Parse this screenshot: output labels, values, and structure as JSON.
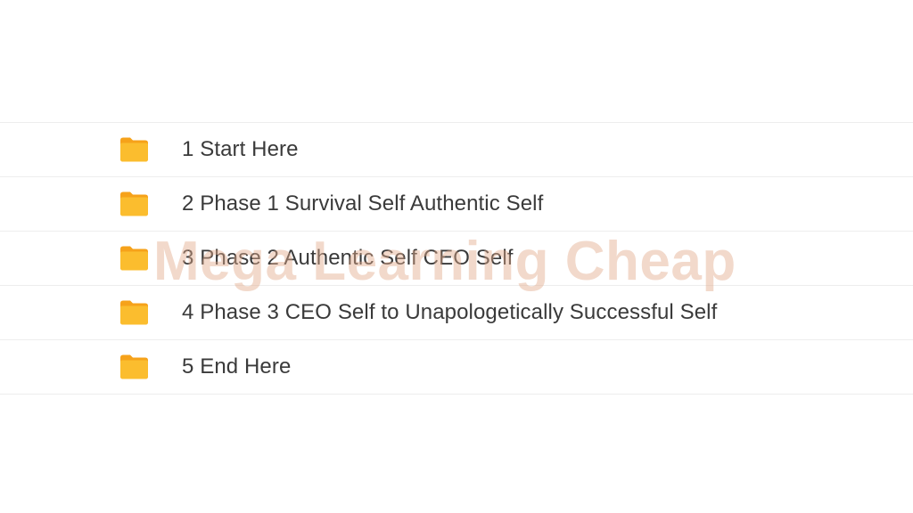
{
  "folders": [
    {
      "label": "1 Start Here",
      "icon": "folder-icon"
    },
    {
      "label": "2 Phase 1 Survival Self Authentic Self",
      "icon": "folder-icon"
    },
    {
      "label": "3 Phase 2 Authentic Self CEO Self",
      "icon": "folder-icon"
    },
    {
      "label": "4 Phase 3 CEO Self to Unapologetically Successful Self",
      "icon": "folder-icon"
    },
    {
      "label": "5 End Here",
      "icon": "folder-icon"
    }
  ],
  "watermark": {
    "text": "Mega Learning Cheap"
  },
  "colors": {
    "folder": "#f9a825",
    "folder_light": "#fbbd2e",
    "text": "#3a3a3a",
    "divider": "#ededed",
    "watermark": "#e2aa8c"
  }
}
